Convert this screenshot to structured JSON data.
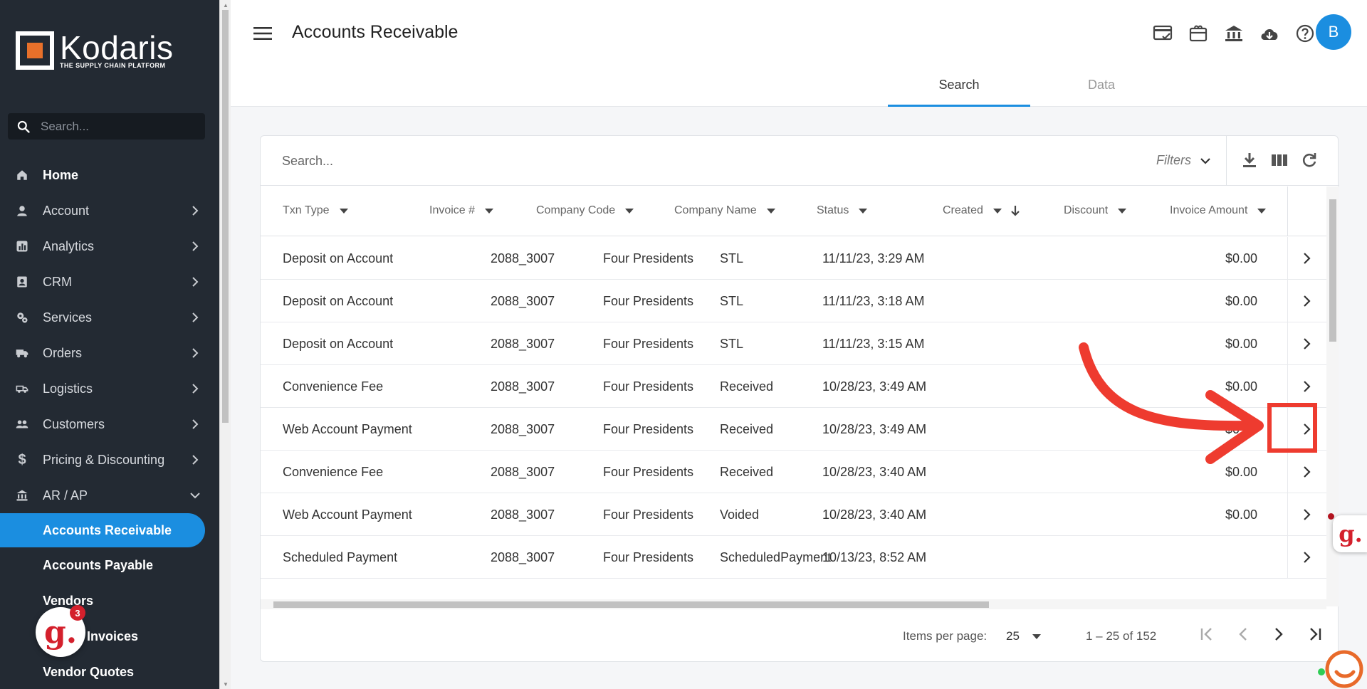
{
  "app": {
    "logo_name": "Kodaris",
    "logo_tagline": "THE SUPPLY CHAIN PLATFORM"
  },
  "sidebar": {
    "search_placeholder": "Search...",
    "items": [
      {
        "label": "Home",
        "icon": "home-icon"
      },
      {
        "label": "Account",
        "icon": "person-icon"
      },
      {
        "label": "Analytics",
        "icon": "analytics-icon"
      },
      {
        "label": "CRM",
        "icon": "contacts-icon"
      },
      {
        "label": "Services",
        "icon": "gears-icon"
      },
      {
        "label": "Orders",
        "icon": "truck-icon"
      },
      {
        "label": "Logistics",
        "icon": "delivery-icon"
      },
      {
        "label": "Customers",
        "icon": "people-icon"
      },
      {
        "label": "Pricing & Discounting",
        "icon": "dollar-icon"
      },
      {
        "label": "AR / AP",
        "icon": "bank-icon"
      }
    ],
    "sub_items": [
      {
        "label": "Accounts Receivable",
        "active": true
      },
      {
        "label": "Accounts Payable"
      },
      {
        "label": "Vendors"
      },
      {
        "label": "Invoices"
      },
      {
        "label": "Vendor Quotes"
      }
    ]
  },
  "header": {
    "title": "Accounts Receivable",
    "avatar_initial": "B",
    "tabs": [
      {
        "label": "Search",
        "active": true
      },
      {
        "label": "Data"
      }
    ]
  },
  "toolbar": {
    "search_placeholder": "Search...",
    "filters_label": "Filters"
  },
  "table": {
    "columns": [
      "Txn Type",
      "Invoice #",
      "Company Code",
      "Company Name",
      "Status",
      "Created",
      "Discount",
      "Invoice Amount"
    ],
    "rows": [
      {
        "txn_type": "Deposit on Account",
        "invoice": "",
        "company_code": "2088_3007",
        "company_name": "Four Presidents",
        "status": "STL",
        "created": "11/11/23, 3:29 AM",
        "discount": "",
        "amount": "$0.00"
      },
      {
        "txn_type": "Deposit on Account",
        "invoice": "",
        "company_code": "2088_3007",
        "company_name": "Four Presidents",
        "status": "STL",
        "created": "11/11/23, 3:18 AM",
        "discount": "",
        "amount": "$0.00"
      },
      {
        "txn_type": "Deposit on Account",
        "invoice": "",
        "company_code": "2088_3007",
        "company_name": "Four Presidents",
        "status": "STL",
        "created": "11/11/23, 3:15 AM",
        "discount": "",
        "amount": "$0.00"
      },
      {
        "txn_type": "Convenience Fee",
        "invoice": "",
        "company_code": "2088_3007",
        "company_name": "Four Presidents",
        "status": "Received",
        "created": "10/28/23, 3:49 AM",
        "discount": "",
        "amount": "$0.00"
      },
      {
        "txn_type": "Web Account Payment",
        "invoice": "",
        "company_code": "2088_3007",
        "company_name": "Four Presidents",
        "status": "Received",
        "created": "10/28/23, 3:49 AM",
        "discount": "",
        "amount": "$0.00"
      },
      {
        "txn_type": "Convenience Fee",
        "invoice": "",
        "company_code": "2088_3007",
        "company_name": "Four Presidents",
        "status": "Received",
        "created": "10/28/23, 3:40 AM",
        "discount": "",
        "amount": "$0.00"
      },
      {
        "txn_type": "Web Account Payment",
        "invoice": "",
        "company_code": "2088_3007",
        "company_name": "Four Presidents",
        "status": "Voided",
        "created": "10/28/23, 3:40 AM",
        "discount": "",
        "amount": "$0.00"
      },
      {
        "txn_type": "Scheduled Payment",
        "invoice": "",
        "company_code": "2088_3007",
        "company_name": "Four Presidents",
        "status": "ScheduledPayment",
        "created": "10/13/23, 8:52 AM",
        "discount": "",
        "amount": ""
      }
    ]
  },
  "pagination": {
    "items_per_page_label": "Items per page:",
    "items_per_page": "25",
    "range": "1 – 25 of 152"
  },
  "overlays": {
    "badge_letter": "g.",
    "badge_count": "3"
  },
  "colors": {
    "accent": "#1b8ee0",
    "sidebar_bg": "#232a33",
    "annotation": "#ee3b2f",
    "logo_orange": "#e8702a"
  }
}
